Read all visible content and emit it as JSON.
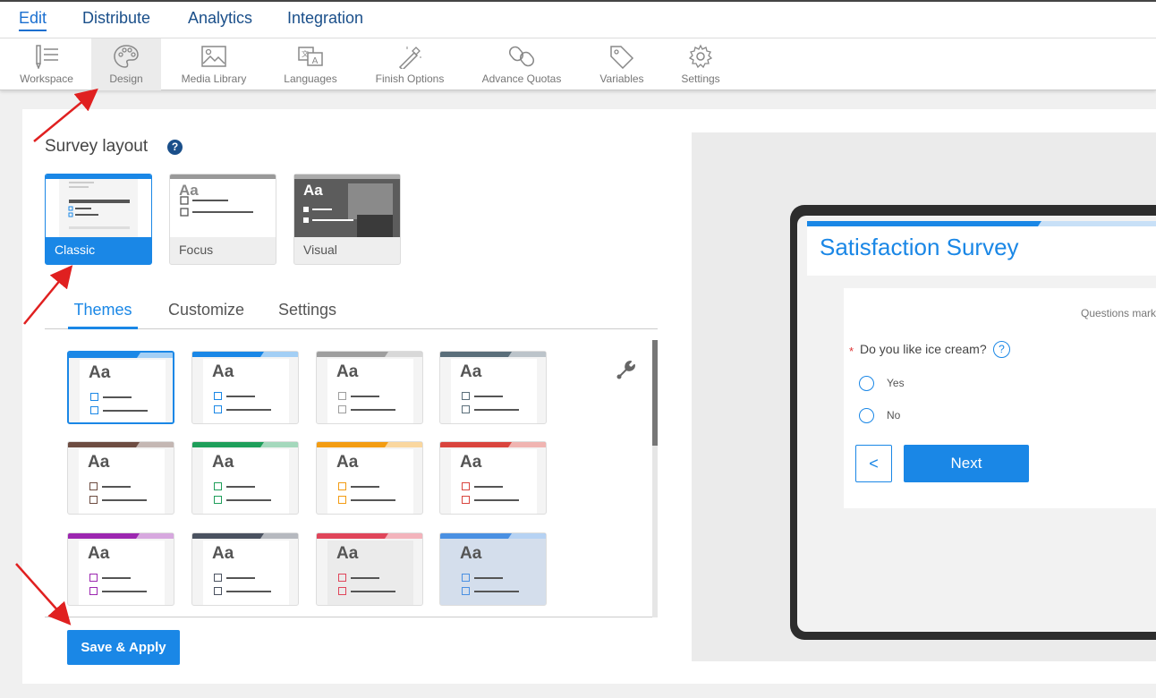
{
  "menu": {
    "edit": "Edit",
    "distribute": "Distribute",
    "analytics": "Analytics",
    "integration": "Integration"
  },
  "toolbar": {
    "workspace": "Workspace",
    "design": "Design",
    "media_library": "Media Library",
    "languages": "Languages",
    "finish_options": "Finish Options",
    "advance_quotas": "Advance Quotas",
    "variables": "Variables",
    "settings": "Settings"
  },
  "survey_layout": {
    "title": "Survey layout",
    "help": "?",
    "options": [
      {
        "label": "Classic",
        "selected": true
      },
      {
        "label": "Focus",
        "selected": false
      },
      {
        "label": "Visual",
        "selected": false
      }
    ],
    "preview_text": "Aa"
  },
  "tabs": {
    "themes": "Themes",
    "customize": "Customize",
    "settings": "Settings",
    "active": "Themes"
  },
  "themes": {
    "sample": "Aa",
    "colors": [
      "#1a87e6",
      "#1a87e6",
      "#9e9e9e",
      "#5a6e7a",
      "#6d4c41",
      "#1e9e5a",
      "#f39c12",
      "#d9443d",
      "#9c27b0",
      "#4a5260",
      "#e0455a",
      "#4a90e2"
    ],
    "selected_index": 0
  },
  "save_button": "Save & Apply",
  "preview": {
    "survey_title": "Satisfaction Survey",
    "required_note": "Questions mark",
    "question": "Do you like ice cream?",
    "question_help": "?",
    "options": [
      "Yes",
      "No"
    ],
    "back": "<",
    "next": "Next"
  },
  "colors": {
    "accent": "#1a87e6",
    "menu_text": "#1a4f8a",
    "annotation_arrows": "#e02020"
  }
}
